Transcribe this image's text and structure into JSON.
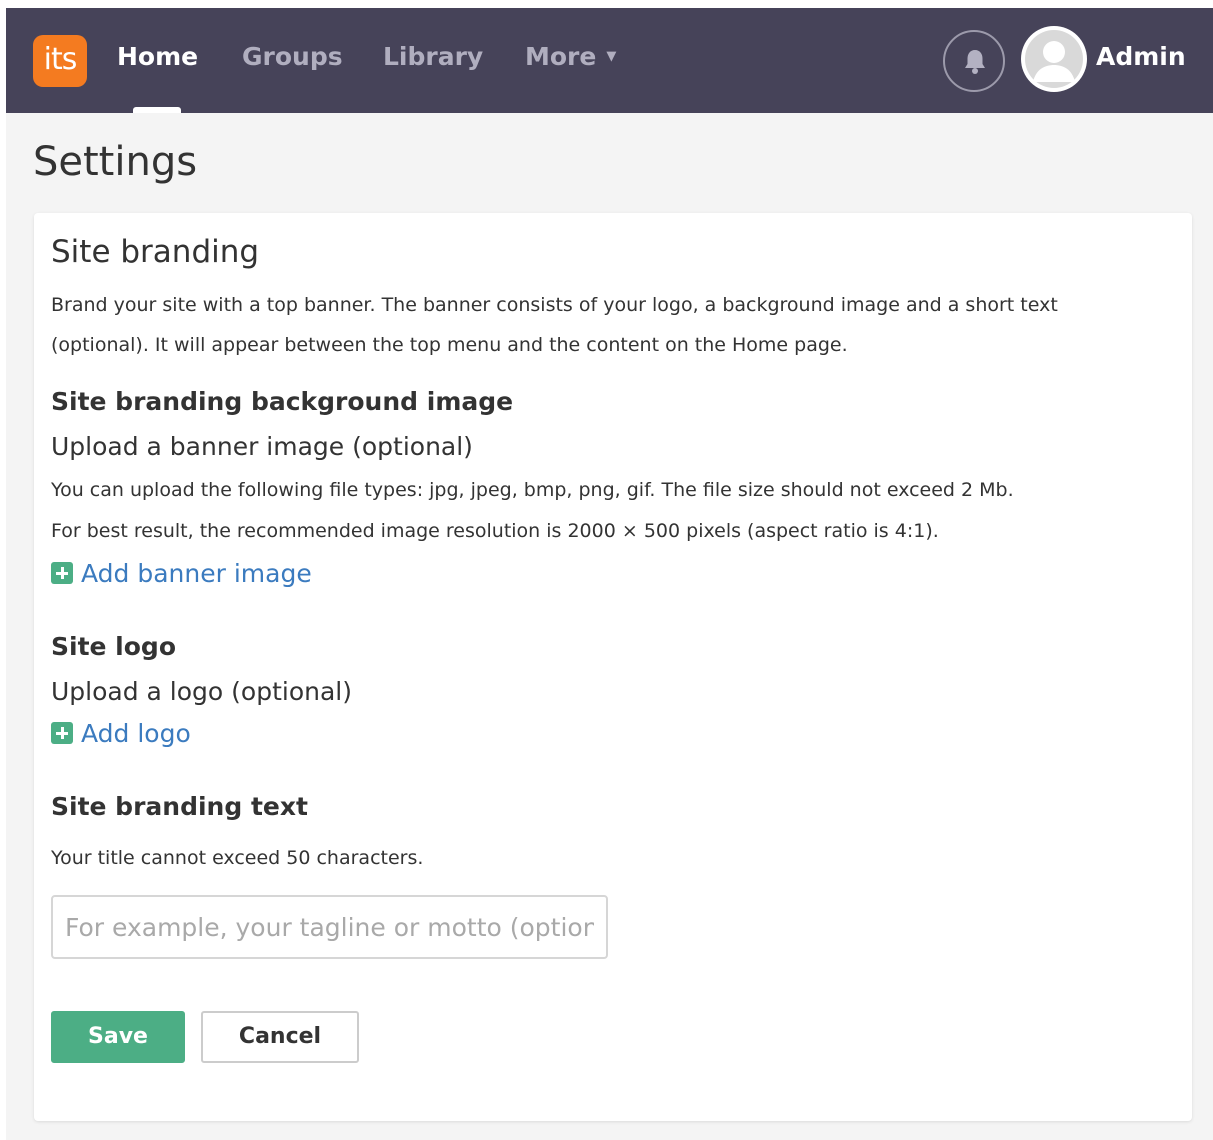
{
  "nav": {
    "logo_text": "its",
    "items": [
      {
        "label": "Home",
        "active": true
      },
      {
        "label": "Groups",
        "active": false
      },
      {
        "label": "Library",
        "active": false
      },
      {
        "label": "More",
        "active": false
      }
    ],
    "more_caret": "▼",
    "user_name": "Admin",
    "icons": [
      "bell-icon",
      "avatar-icon"
    ]
  },
  "page": {
    "title": "Settings"
  },
  "branding": {
    "title": "Site branding",
    "description": "Brand your site with a top banner. The banner consists of your logo, a background image and a short text (optional). It will appear between the top menu and the content on the Home page.",
    "background": {
      "heading": "Site branding background image",
      "subheading": "Upload a banner image (optional)",
      "file_types_note": "You can upload the following file types: jpg, jpeg, bmp, png, gif. The file size should not exceed 2 Mb.",
      "resolution_note": "For best result, the recommended image resolution is 2000 × 500 pixels (aspect ratio is 4:1).",
      "add_label": "Add banner image"
    },
    "logo": {
      "heading": "Site logo",
      "subheading": "Upload a logo (optional)",
      "add_label": "Add logo"
    },
    "text": {
      "heading": "Site branding text",
      "limit_note": "Your title cannot exceed 50 characters.",
      "value": "",
      "placeholder": "For example, your tagline or motto (optional)"
    }
  },
  "actions": {
    "save_label": "Save",
    "cancel_label": "Cancel"
  },
  "colors": {
    "navbar_bg": "#464359",
    "logo_bg": "#f47b20",
    "accent_green": "#4cae85",
    "link_blue": "#3b7bbf",
    "page_bg": "#f4f4f4"
  }
}
